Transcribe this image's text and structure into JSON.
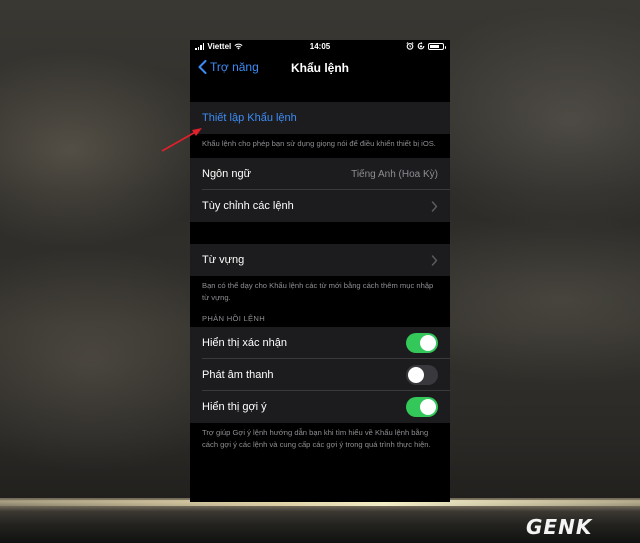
{
  "status_bar": {
    "carrier": "Viettel",
    "time": "14:05",
    "battery_level": 0.75
  },
  "nav": {
    "back_label": "Trợ năng",
    "title": "Khẩu lệnh"
  },
  "setup": {
    "link_label": "Thiết lập Khẩu lệnh",
    "description": "Khẩu lệnh cho phép bạn sử dụng giọng nói để điều khiển thiết bị iOS."
  },
  "language": {
    "label": "Ngôn ngữ",
    "value": "Tiếng Anh (Hoa Kỳ)"
  },
  "customize": {
    "label": "Tùy chỉnh các lệnh"
  },
  "vocabulary": {
    "label": "Từ vựng",
    "description": "Bạn có thể dạy cho Khẩu lệnh các từ mới bằng cách thêm mục nhập từ vựng."
  },
  "feedback": {
    "header": "PHẢN HỒI LỆNH",
    "items": [
      {
        "label": "Hiển thị xác nhận",
        "on": true
      },
      {
        "label": "Phát âm thanh",
        "on": false
      },
      {
        "label": "Hiển thị gợi ý",
        "on": true
      }
    ],
    "description": "Trợ giúp Gợi ý lệnh hướng dẫn bạn khi tìm hiểu về Khẩu lệnh bằng cách gợi ý các lệnh và cung cấp các gợi ý trong quá trình thực hiện."
  },
  "watermark": {
    "logo_text": "GENK"
  },
  "colors": {
    "accent": "#3d8cf5",
    "toggle_on": "#34c759",
    "annotation_arrow": "#e0202a"
  },
  "icons": {
    "back": "chevron-left-icon",
    "disclosure": "chevron-right-icon"
  }
}
